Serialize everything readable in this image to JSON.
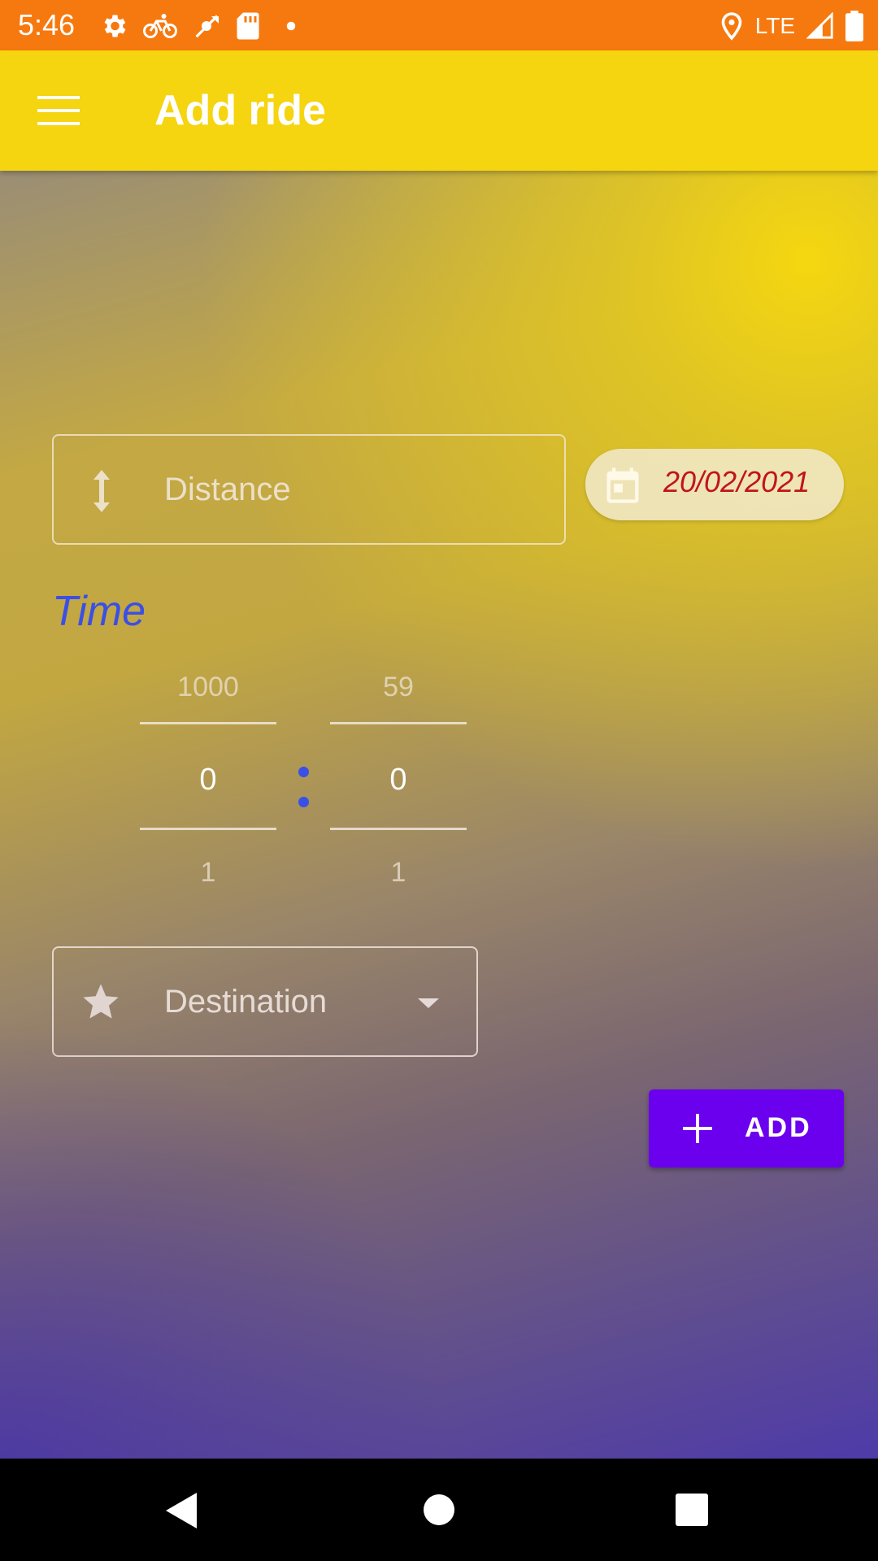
{
  "status_bar": {
    "time": "5:46",
    "network": "LTE",
    "icons_left": [
      "settings-icon",
      "bike-icon",
      "wifi-off-icon",
      "sd-card-icon",
      "dot-icon"
    ],
    "icons_right": [
      "location-icon",
      "signal-icon",
      "battery-icon"
    ]
  },
  "app_bar": {
    "title": "Add ride",
    "menu_icon": "menu-icon",
    "color": "#f5d410"
  },
  "form": {
    "distance": {
      "placeholder": "Distance",
      "icon": "vertical-arrows-icon"
    },
    "date": {
      "value": "20/02/2021",
      "icon": "calendar-icon",
      "text_color": "#c0151c"
    },
    "time": {
      "label": "Time",
      "hours": {
        "prev": "1000",
        "current": "0",
        "next": "1"
      },
      "minutes": {
        "prev": "59",
        "current": "0",
        "next": "1"
      }
    },
    "destination": {
      "placeholder": "Destination",
      "icon": "star-icon",
      "dropdown_icon": "dropdown-arrow-icon"
    },
    "add_button": {
      "label": "ADD",
      "icon": "plus-icon",
      "color": "#6a00ee"
    }
  },
  "nav_bar": {
    "buttons": [
      "back-icon",
      "home-icon",
      "recents-icon"
    ]
  }
}
